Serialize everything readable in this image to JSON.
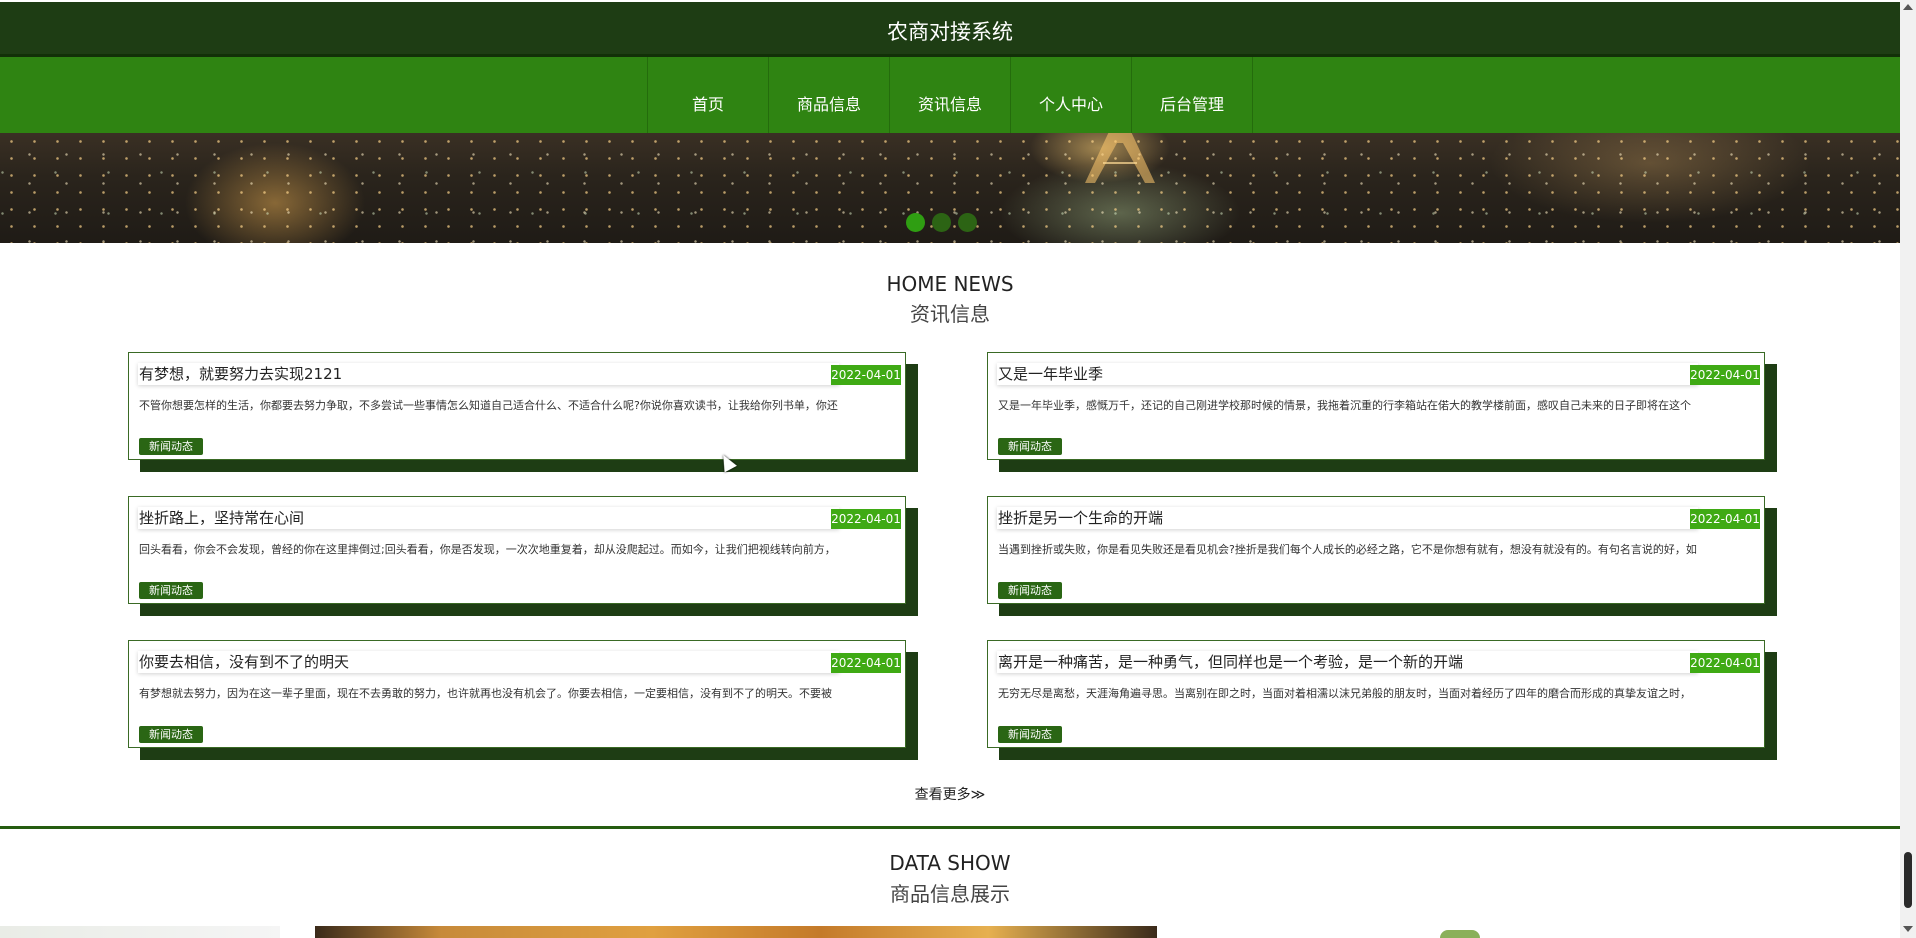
{
  "header": {
    "site_title": "农商对接系统",
    "nav": [
      "首页",
      "商品信息",
      "资讯信息",
      "个人中心",
      "后台管理"
    ]
  },
  "banner": {
    "dots": [
      {
        "active": true
      },
      {
        "active": false
      },
      {
        "active": false
      }
    ]
  },
  "news_section": {
    "title_en": "HOME NEWS",
    "title_cn": "资讯信息",
    "items": [
      {
        "title": "有梦想，就要努力去实现2121",
        "date": "2022-04-01",
        "summary": "不管你想要怎样的生活，你都要去努力争取，不多尝试一些事情怎么知道自己适合什么、不适合什么呢?你说你喜欢读书，让我给你列书单，你还",
        "tag": "新闻动态"
      },
      {
        "title": "又是一年毕业季",
        "date": "2022-04-01",
        "summary": "又是一年毕业季，感慨万千，还记的自己刚进学校那时候的情景，我拖着沉重的行李箱站在偌大的教学楼前面，感叹自己未来的日子即将在这个",
        "tag": "新闻动态"
      },
      {
        "title": "挫折路上，坚持常在心间",
        "date": "2022-04-01",
        "summary": "回头看看，你会不会发现，曾经的你在这里摔倒过;回头看看，你是否发现，一次次地重复着，却从没爬起过。而如今，让我们把视线转向前方，",
        "tag": "新闻动态"
      },
      {
        "title": "挫折是另一个生命的开端",
        "date": "2022-04-01",
        "summary": "当遇到挫折或失败，你是看见失败还是看见机会?挫折是我们每个人成长的必经之路，它不是你想有就有，想没有就没有的。有句名言说的好，如",
        "tag": "新闻动态"
      },
      {
        "title": "你要去相信，没有到不了的明天",
        "date": "2022-04-01",
        "summary": "有梦想就去努力，因为在这一辈子里面，现在不去勇敢的努力，也许就再也没有机会了。你要去相信，一定要相信，没有到不了的明天。不要被",
        "tag": "新闻动态"
      },
      {
        "title": "离开是一种痛苦，是一种勇气，但同样也是一个考验，是一个新的开端",
        "date": "2022-04-01",
        "summary": "无穷无尽是离愁，天涯海角遍寻思。当离别在即之时，当面对着相濡以沫兄弟般的朋友时，当面对着经历了四年的磨合而形成的真挚友谊之时，",
        "tag": "新闻动态"
      }
    ],
    "more_label": "查看更多≫"
  },
  "data_section": {
    "title_en": "DATA SHOW",
    "title_cn": "商品信息展示"
  }
}
